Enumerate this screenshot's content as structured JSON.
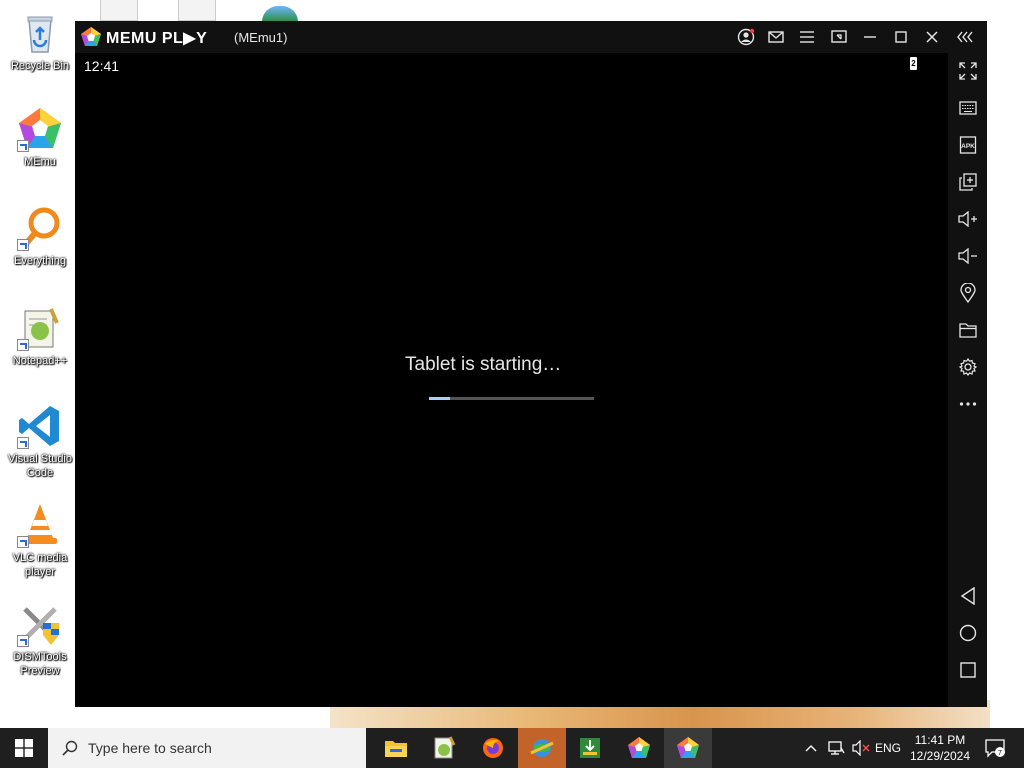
{
  "desktop": {
    "icons": [
      {
        "label": "Recycle Bin",
        "icon": "recycle-bin-icon"
      },
      {
        "label": "MEmu",
        "icon": "memu-icon"
      },
      {
        "label": "Everything",
        "icon": "everything-search-icon"
      },
      {
        "label": "Notepad++",
        "icon": "notepad-plus-plus-icon"
      },
      {
        "label": "Visual Studio Code",
        "icon": "vscode-icon"
      },
      {
        "label": "VLC media player",
        "icon": "vlc-icon"
      },
      {
        "label": "DISMTools Preview",
        "icon": "dismtools-icon"
      }
    ]
  },
  "emulator": {
    "brand": "MEMU PL▶Y",
    "instance": "(MEmu1)",
    "status_time": "12:41",
    "battery_level": "2",
    "message": "Tablet is starting…",
    "progress_fraction": 0.13,
    "title_buttons": [
      "account-icon",
      "mail-icon",
      "menu-icon",
      "screen-cast-icon",
      "minimize-icon",
      "maximize-icon",
      "close-icon",
      "collapse-sidebar-icon"
    ],
    "sidebar_buttons": [
      "fullscreen-icon",
      "keyboard-icon",
      "apk-icon",
      "multi-window-icon",
      "volume-up-icon",
      "volume-down-icon",
      "location-icon",
      "folder-icon",
      "settings-icon",
      "more-icon",
      "back-icon",
      "home-icon",
      "recents-icon"
    ],
    "apk_label": "APK"
  },
  "taskbar": {
    "search_placeholder": "Type here to search",
    "apps": [
      "file-explorer-icon",
      "notepad-plus-plus-icon",
      "firefox-icon",
      "network-globe-icon",
      "green-app-icon",
      "memu-icon",
      "memu-multi-icon"
    ],
    "tray": {
      "language": "ENG",
      "time": "11:41 PM",
      "date": "12/29/2024",
      "notifications": "7"
    }
  },
  "colors": {
    "emulator_bg": "#000000",
    "progress_fill": "#9fd0ff",
    "taskbar_bg": "#1f1f1f"
  }
}
